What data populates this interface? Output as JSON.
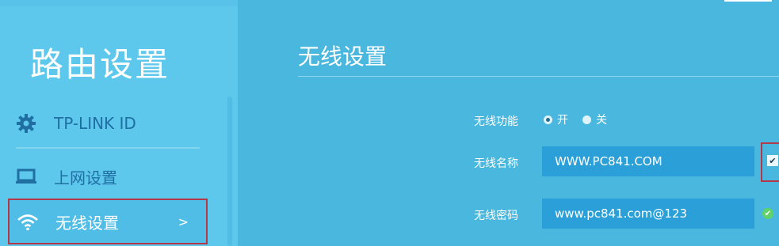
{
  "sidebar": {
    "title": "路由设置",
    "items": [
      {
        "label": "TP-LINK ID",
        "icon": "gear-icon"
      },
      {
        "label": "上网设置",
        "icon": "monitor-icon"
      },
      {
        "label": "无线设置",
        "icon": "wifi-icon",
        "chevron": ">",
        "active": true
      }
    ]
  },
  "main": {
    "title": "无线设置",
    "wireless_function": {
      "label": "无线功能",
      "options": [
        "开",
        "关"
      ],
      "selected": "开"
    },
    "ssid": {
      "label": "无线名称",
      "value": "WWW.PC841.COM",
      "checkbox": "✔"
    },
    "password": {
      "label": "无线密码",
      "value": "www.pc841.com@123",
      "status_icon": "✔"
    }
  },
  "colors": {
    "background": "#49b7de",
    "sidebar": "#5ec8ec",
    "field": "#2a9fd8",
    "highlight_border": "#b5374a",
    "ok": "#5fd36a"
  }
}
